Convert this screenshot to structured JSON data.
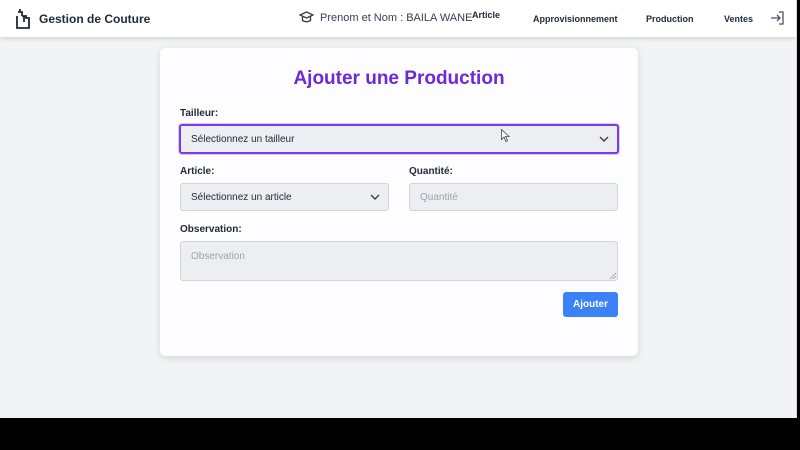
{
  "header": {
    "app_title": "Gestion de Couture",
    "user_text": "Prenom et Nom : BAILA WANE",
    "nav": [
      "Article",
      "Approvisionnement",
      "Production",
      "Ventes"
    ]
  },
  "form": {
    "title": "Ajouter une Production",
    "tailleur_label": "Tailleur:",
    "tailleur_value": "Sélectionnez un tailleur",
    "article_label": "Article:",
    "article_value": "Sélectionnez un article",
    "quantite_label": "Quantité:",
    "quantite_placeholder": "Quantité",
    "observation_label": "Observation:",
    "observation_placeholder": "Observation",
    "submit_label": "Ajouter"
  },
  "colors": {
    "accent": "#6d28d9",
    "button": "#3b82f6",
    "focus_border": "#7c3aed"
  }
}
